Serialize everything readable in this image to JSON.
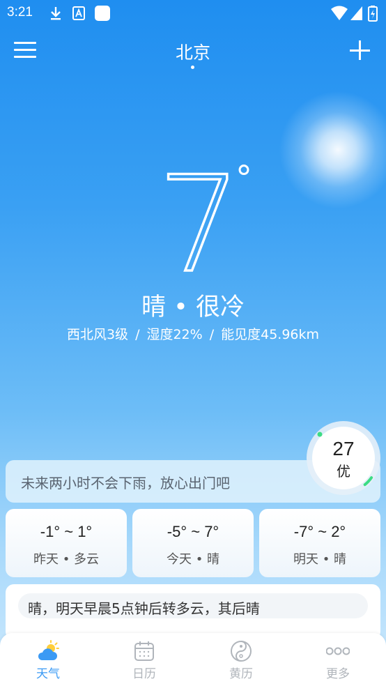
{
  "status_bar": {
    "time": "3:21"
  },
  "header": {
    "city": "北京"
  },
  "current": {
    "temperature": "7",
    "degree": "°",
    "condition": "晴 • 很冷",
    "wind": "西北风3级",
    "humidity": "湿度22%",
    "visibility": "能见度45.96km",
    "separator": "/"
  },
  "rain_notice": "未来两小时不会下雨，放心出门吧",
  "aqi": {
    "value": "27",
    "level": "优",
    "fraction": 0.18
  },
  "days": [
    {
      "range": "-1° ~ 1°",
      "desc": "昨天 • 多云"
    },
    {
      "range": "-5° ~ 7°",
      "desc": "今天 • 晴"
    },
    {
      "range": "-7° ~ 2°",
      "desc": "明天 • 晴"
    }
  ],
  "summary": "晴，明天早晨5点钟后转多云，其后晴",
  "bottom_nav": [
    {
      "label": "天气",
      "icon": "weather-icon",
      "active": true
    },
    {
      "label": "日历",
      "icon": "calendar-icon",
      "active": false
    },
    {
      "label": "黄历",
      "icon": "yin-yang-icon",
      "active": false
    },
    {
      "label": "更多",
      "icon": "more-icon",
      "active": false
    }
  ],
  "colors": {
    "accent": "#3b9af4",
    "aqi_green": "#3ddc84"
  }
}
